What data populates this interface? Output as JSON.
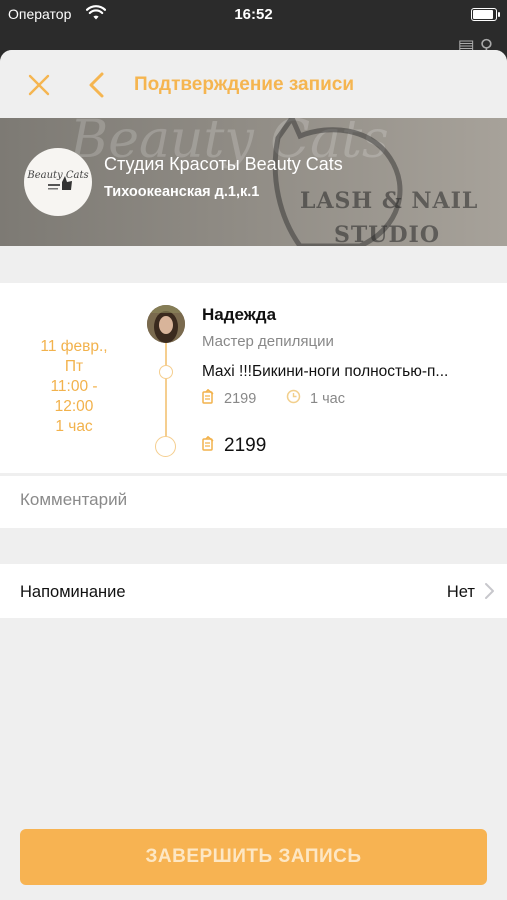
{
  "status_bar": {
    "carrier": "Оператор",
    "time": "16:52",
    "wifi_icon": "wifi-icon",
    "battery_icon": "battery-icon"
  },
  "nav": {
    "title": "Подтверждение записи",
    "close_icon": "close-icon",
    "back_icon": "chevron-left-icon"
  },
  "studio": {
    "name": "Студия Красоты Beauty Cats",
    "address": "Тихоокеанская д.1,к.1",
    "logo_text": "Beauty Cats",
    "banner_text_1": "Beauty Cats",
    "banner_text_2": "LASH & NAIL",
    "banner_text_3": "STUDIO"
  },
  "appointment": {
    "date_line1": "11 февр.,",
    "date_line2": "Пт",
    "time_start": "11:00 -",
    "time_end": "12:00",
    "duration": "1 час",
    "master_name": "Надежда",
    "master_role": "Мастер депиляции",
    "service": "Maxi !!!Бикини-ноги полностью-п...",
    "service_price": "2199",
    "service_duration": "1 час",
    "total_price": "2199"
  },
  "comment": {
    "placeholder": "Комментарий",
    "value": ""
  },
  "reminder": {
    "label": "Напоминание",
    "value": "Нет"
  },
  "actions": {
    "finish_label": "ЗАВЕРШИТЬ ЗАПИСЬ"
  },
  "colors": {
    "accent": "#f5b550",
    "button": "#f7b352",
    "button_text": "#fde7c4",
    "timeline": "#f5ce8f",
    "sheet_bg": "#efefef"
  }
}
